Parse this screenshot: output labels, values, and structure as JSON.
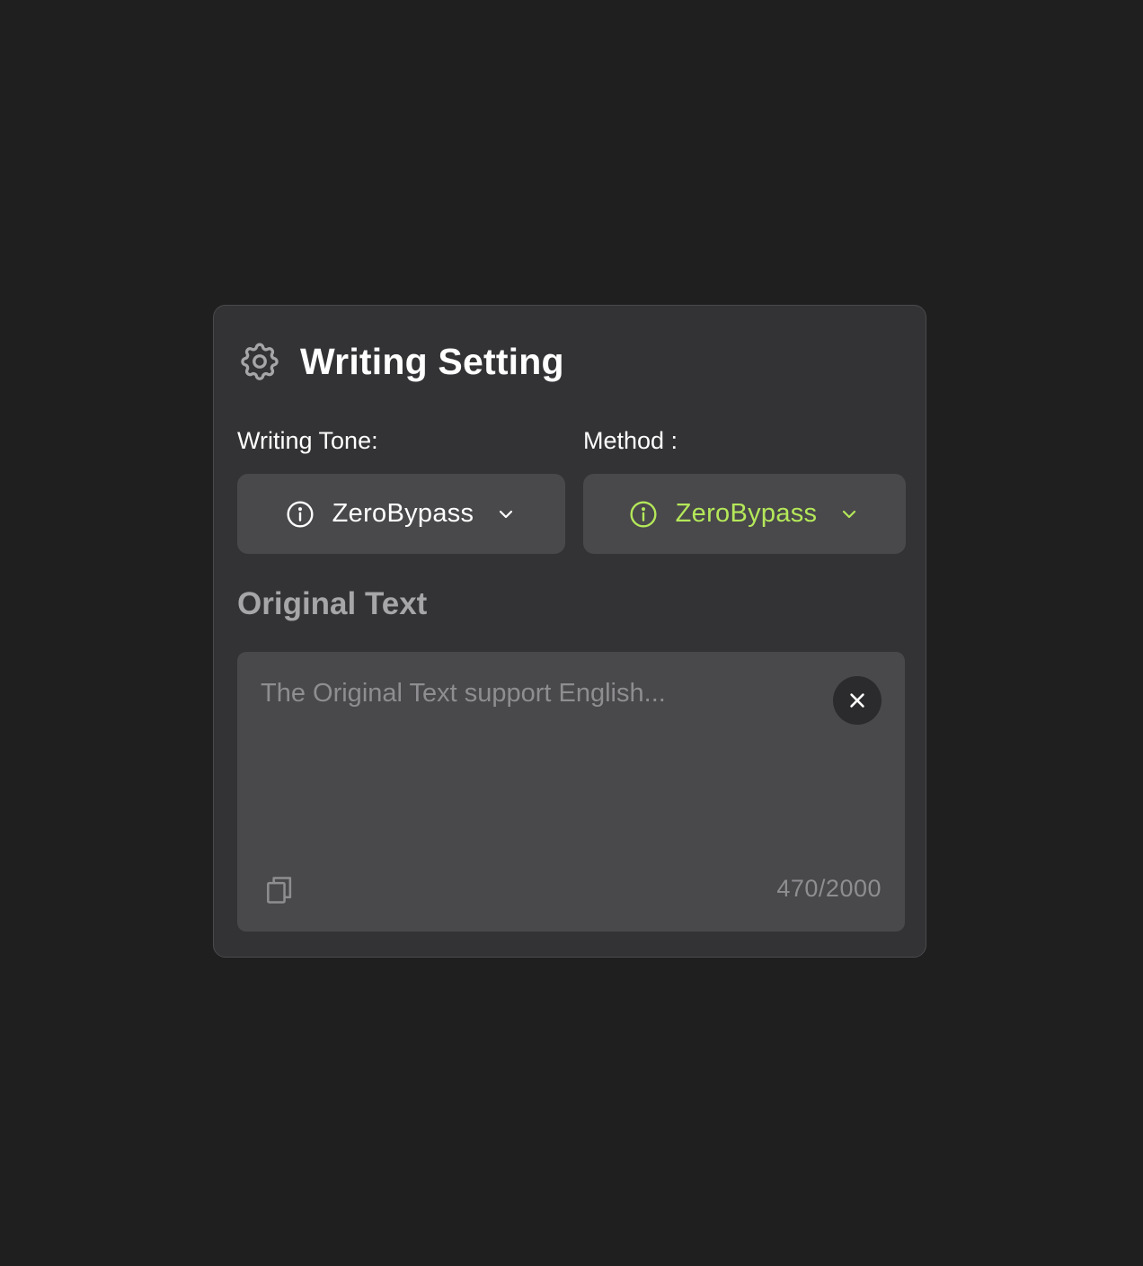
{
  "header": {
    "icon": "gear-icon",
    "title": "Writing Setting"
  },
  "tone": {
    "label": "Writing Tone:",
    "selected": "ZeroBypass",
    "icon": "info-icon",
    "color": "#ffffff"
  },
  "method": {
    "label": "Method :",
    "selected": "ZeroBypass",
    "icon": "info-icon",
    "color": "#b4e859"
  },
  "original": {
    "title": "Original Text",
    "value": "",
    "placeholder": "The Original Text support English...",
    "counter": "470/2000",
    "clear_icon": "close-icon",
    "copy_icon": "copy-icon"
  },
  "colors": {
    "background": "#201f20",
    "panel": "#333234",
    "control": "#49484b",
    "accent": "#b4e859"
  }
}
